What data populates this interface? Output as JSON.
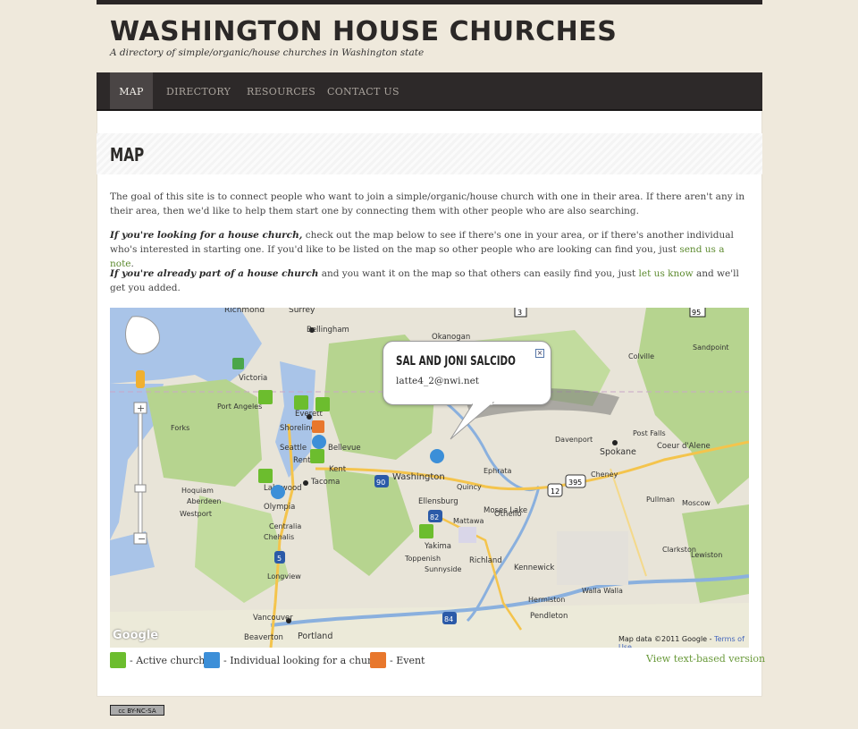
{
  "site": {
    "title": "WASHINGTON HOUSE CHURCHES",
    "tagline": "A directory of simple/organic/house churches in Washington state"
  },
  "nav": {
    "items": [
      {
        "label": "MAP",
        "active": true
      },
      {
        "label": "DIRECTORY",
        "active": false
      },
      {
        "label": "RESOURCES",
        "active": false
      },
      {
        "label": "CONTACT US",
        "active": false
      }
    ]
  },
  "page": {
    "heading": "MAP",
    "intro": "The goal of this site is to connect people who want to join a simple/organic/house church with one in their area. If there aren't any in their area, then we'd like to help them start one by connecting them with other people who are also searching.",
    "p2": {
      "bold": "If you're looking for a house church,",
      "text": " check out the map below to see if there's one in your area, or if there's another individual who's interested in starting one. If you'd like to be listed on the map so other people who are looking can find you, just ",
      "link": "send us a note",
      "end": "."
    },
    "p3": {
      "bold": "If you're already part of a house church",
      "text": " and you want it on the map so that others can easily find you, just ",
      "link": "let us know",
      "end": " and we'll get you added."
    }
  },
  "map": {
    "info_window": {
      "title": "SAL AND JONI SALCIDO",
      "email": "latte4_2@nwi.net",
      "close": "×"
    },
    "google_logo": "Google",
    "attribution": "Map data ©2011 Google - ",
    "terms": "Terms of Use",
    "place_labels": [
      "Richmond",
      "Surrey",
      "Bellingham",
      "Okanogan",
      "Victoria",
      "Everett",
      "Shoreline",
      "Seattle",
      "Bellevue",
      "Renton",
      "Kent",
      "Tacoma",
      "Lakewood",
      "Olympia",
      "Washington",
      "Ellensburg",
      "Spokane",
      "Coeur d'Alene",
      "Post Falls",
      "Moses Lake",
      "Othello",
      "Yakima",
      "Richland",
      "Kennewick",
      "Pendleton",
      "Walla Walla",
      "Vancouver",
      "Portland",
      "Beaverton",
      "Hermiston",
      "Ephrata",
      "Quincy",
      "Davenport",
      "Cheney",
      "Toppenish",
      "Sunnyside",
      "Mattawa",
      "Aberdeen",
      "Hoquiam",
      "Westport",
      "Port Angeles",
      "Forks",
      "Longview",
      "Chehalis",
      "Centralia",
      "Colville",
      "Sandpoint",
      "Clarkston",
      "Pullman",
      "Moscow",
      "Lewiston"
    ],
    "highways": [
      "3",
      "95",
      "90",
      "395",
      "82",
      "84",
      "5",
      "12"
    ]
  },
  "legend": {
    "active": "- Active church",
    "individual": "- Individual looking for a church",
    "event": "- Event",
    "text_version": "View text-based version",
    "colors": {
      "active": "#6cbd2e",
      "individual": "#3c8fd8",
      "event": "#e8772c"
    }
  },
  "footer": {
    "license": "cc BY-NC-SA"
  }
}
